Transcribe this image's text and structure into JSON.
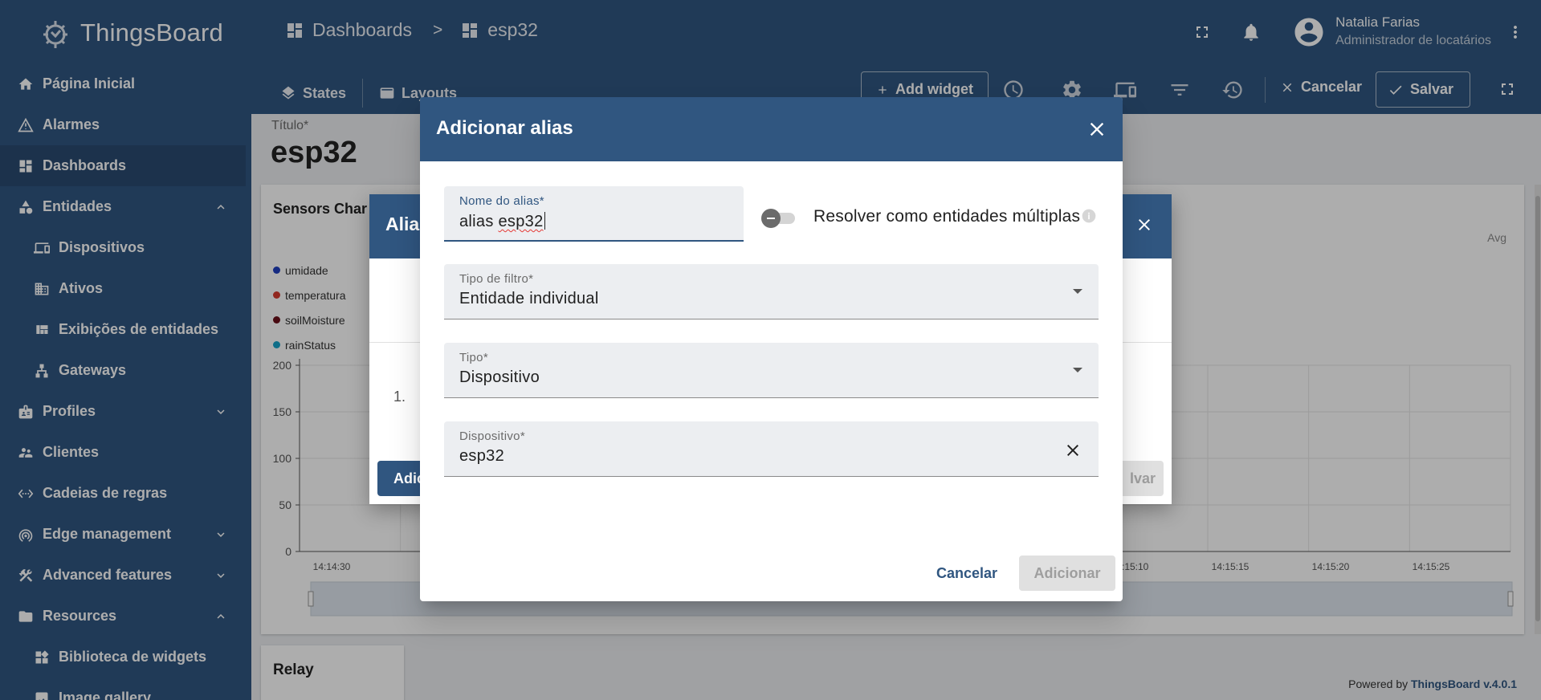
{
  "app": {
    "name": "ThingsBoard",
    "breadcrumb": [
      {
        "label": "Dashboards",
        "icon": "dashboard-icon"
      },
      {
        "label": "esp32",
        "icon": "dashboard-icon"
      }
    ],
    "breadcrumb_separator": ">",
    "user": {
      "name": "Natalia Farias",
      "role": "Administrador de locatários"
    }
  },
  "sidebar": {
    "items": [
      {
        "label": "Página Inicial",
        "icon": "home-icon"
      },
      {
        "label": "Alarmes",
        "icon": "warning-icon"
      },
      {
        "label": "Dashboards",
        "icon": "dashboard-icon",
        "active": true
      },
      {
        "label": "Entidades",
        "icon": "category-icon",
        "expanded": true
      },
      {
        "label": "Dispositivos",
        "icon": "devices-icon",
        "sub": true
      },
      {
        "label": "Ativos",
        "icon": "domain-icon",
        "sub": true
      },
      {
        "label": "Exibições de entidades",
        "icon": "view-quilt-icon",
        "sub": true
      },
      {
        "label": "Gateways",
        "icon": "gateway-icon",
        "sub": true
      },
      {
        "label": "Profiles",
        "icon": "badge-icon",
        "expanded": false
      },
      {
        "label": "Clientes",
        "icon": "supervisor-account-icon"
      },
      {
        "label": "Cadeias de regras",
        "icon": "settings-ethernet-icon"
      },
      {
        "label": "Edge management",
        "icon": "router-icon",
        "expanded": false
      },
      {
        "label": "Advanced features",
        "icon": "construction-icon",
        "expanded": false
      },
      {
        "label": "Resources",
        "icon": "folder-icon",
        "expanded": true
      },
      {
        "label": "Biblioteca de widgets",
        "icon": "widgets-icon",
        "sub": true
      },
      {
        "label": "Image gallery",
        "icon": "image-icon",
        "sub": true
      }
    ]
  },
  "toolbar": {
    "states_label": "States",
    "layouts_label": "Layouts",
    "add_widget_label": "Add widget",
    "cancel_label": "Cancelar",
    "save_label": "Salvar"
  },
  "dashboard": {
    "title_label": "Título*",
    "title_value": "esp32",
    "widget_title": "Sensors Char",
    "avg_label": "Avg",
    "relay_title": "Relay",
    "powered_by": "Powered by",
    "powered_link": "ThingsBoard v.4.0.1"
  },
  "chart_data": {
    "type": "line",
    "title": "Sensors Char",
    "series": [
      {
        "name": "umidade",
        "color": "#1f3fbf"
      },
      {
        "name": "temperatura",
        "color": "#d63a2f"
      },
      {
        "name": "soilMoisture",
        "color": "#6b0f1a"
      },
      {
        "name": "rainStatus",
        "color": "#17a2c9"
      }
    ],
    "y_ticks": [
      "0",
      "50",
      "100",
      "150",
      "200"
    ],
    "ylim": [
      0,
      200
    ],
    "x_ticks": [
      "14:14:30",
      "14:15:10",
      "14:15:15",
      "14:15:20",
      "14:15:25"
    ],
    "legend_position": "left",
    "grid": true
  },
  "behind_dialog": {
    "title": "Alia",
    "row_number": "1.",
    "add_label": "Adic",
    "save_label": "lvar"
  },
  "dialog": {
    "title": "Adicionar alias",
    "alias_name": {
      "label": "Nome do alias*",
      "value_prefix": "alias ",
      "value_word": "esp32"
    },
    "resolve_multiple_label": "Resolver como entidades múltiplas",
    "filter_type": {
      "label": "Tipo de filtro*",
      "value": "Entidade individual"
    },
    "type": {
      "label": "Tipo*",
      "value": "Dispositivo"
    },
    "device": {
      "label": "Dispositivo*",
      "value": "esp32"
    },
    "cancel_label": "Cancelar",
    "add_label": "Adicionar"
  }
}
